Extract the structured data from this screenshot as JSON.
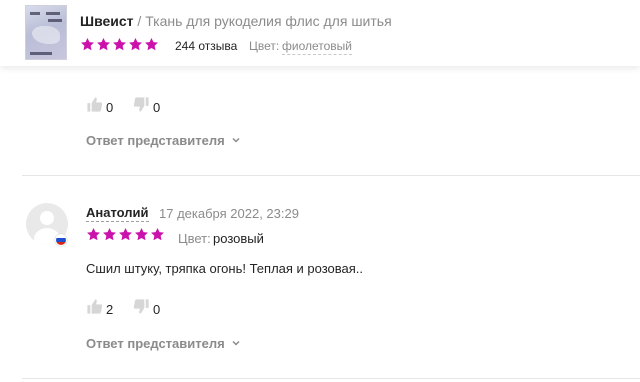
{
  "product": {
    "brand": "Швеист",
    "separator": "/",
    "title": "Ткань для рукоделия флис для шитья",
    "rating_stars": 5,
    "reviews_count": "244 отзыва",
    "color_label": "Цвет:",
    "color_value": "фиолетовый"
  },
  "accent_color": "#cb11ab",
  "previous_review": {
    "likes": "0",
    "dislikes": "0",
    "reply_label": "Ответ представителя"
  },
  "review": {
    "author": "Анатолий",
    "date": "17 декабря 2022, 23:29",
    "rating_stars": 5,
    "color_label": "Цвет:",
    "color_value": "розовый",
    "text": "Сшил штуку, тряпка огонь! Теплая и розовая..",
    "likes": "2",
    "dislikes": "0",
    "reply_label": "Ответ представителя",
    "country_flag": "russia-flag-icon"
  }
}
